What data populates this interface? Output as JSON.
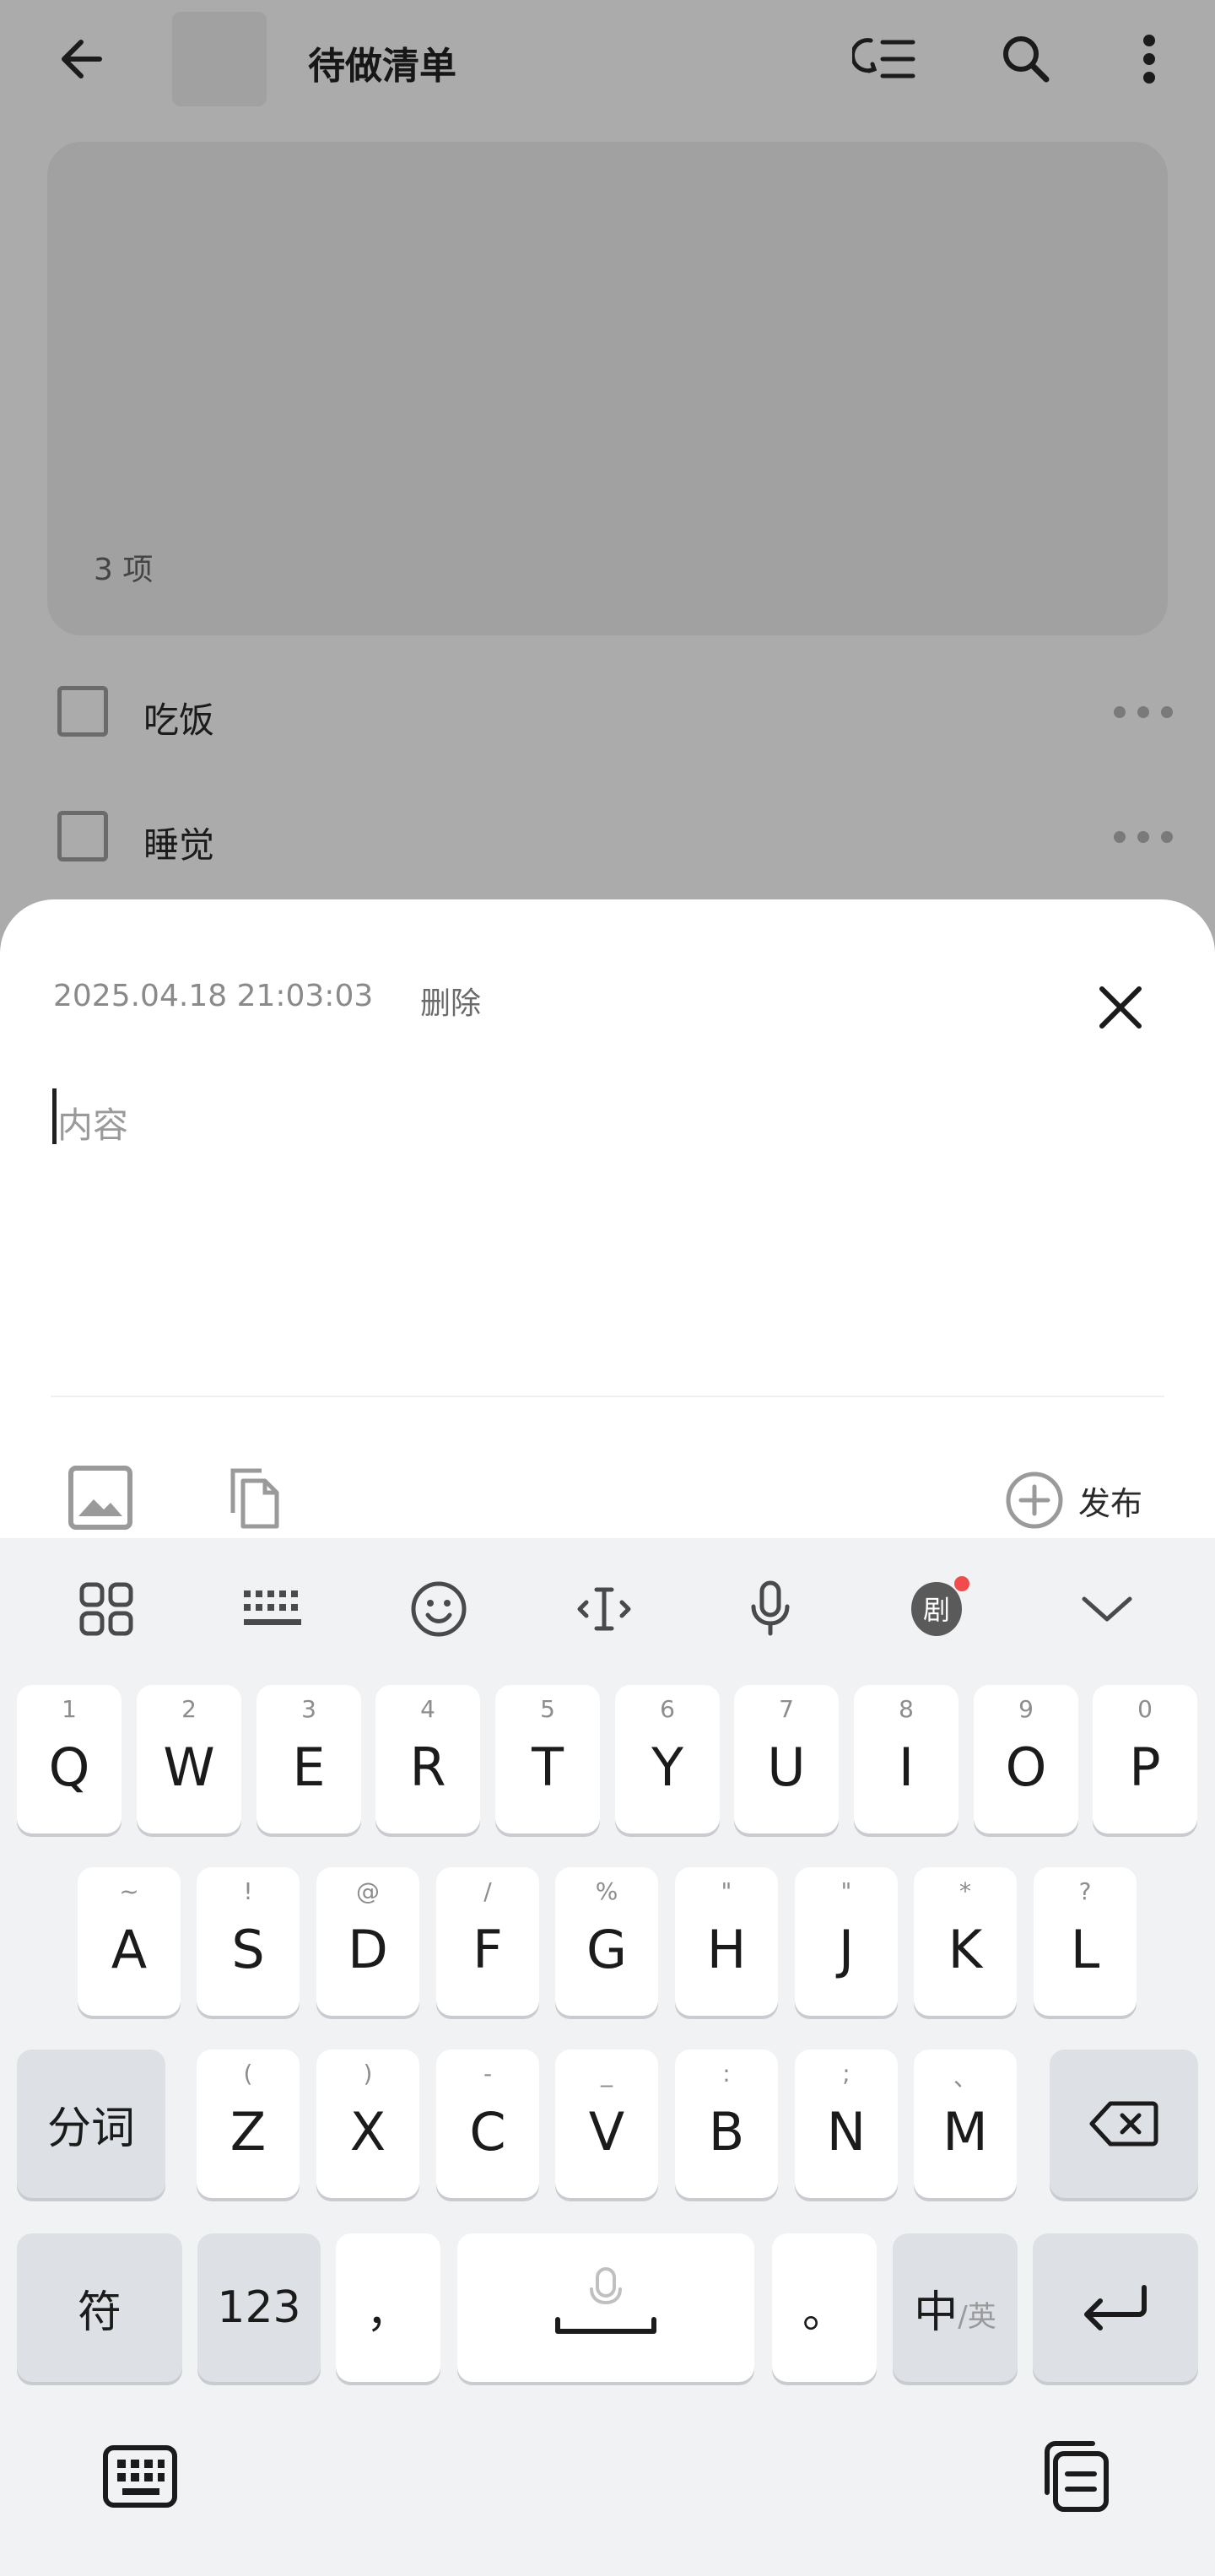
{
  "header": {
    "title": "待做清单",
    "icons": [
      "back-arrow-icon",
      "sort-icon",
      "search-icon",
      "more-vertical-icon"
    ]
  },
  "cover": {
    "count_text": "3 项"
  },
  "todos": [
    {
      "label": "吃饭",
      "checked": false
    },
    {
      "label": "睡觉",
      "checked": false
    }
  ],
  "sheet": {
    "timestamp": "2025.04.18 21:03:03",
    "delete_label": "删除",
    "content_placeholder": "内容",
    "publish_label": "发布"
  },
  "keyboard": {
    "toolbar": [
      "apps-grid-icon",
      "keyboard-layout-icon",
      "emoji-icon",
      "cursor-move-icon",
      "microphone-icon",
      "ju-badge-icon",
      "collapse-chevron-icon"
    ],
    "toolbar_badge_text": "剧",
    "row1": [
      {
        "key": "Q",
        "hint": "1"
      },
      {
        "key": "W",
        "hint": "2"
      },
      {
        "key": "E",
        "hint": "3"
      },
      {
        "key": "R",
        "hint": "4"
      },
      {
        "key": "T",
        "hint": "5"
      },
      {
        "key": "Y",
        "hint": "6"
      },
      {
        "key": "U",
        "hint": "7"
      },
      {
        "key": "I",
        "hint": "8"
      },
      {
        "key": "O",
        "hint": "9"
      },
      {
        "key": "P",
        "hint": "0"
      }
    ],
    "row2": [
      {
        "key": "A",
        "hint": "~"
      },
      {
        "key": "S",
        "hint": "!"
      },
      {
        "key": "D",
        "hint": "@"
      },
      {
        "key": "F",
        "hint": "/"
      },
      {
        "key": "G",
        "hint": "%"
      },
      {
        "key": "H",
        "hint": "\""
      },
      {
        "key": "J",
        "hint": "\""
      },
      {
        "key": "K",
        "hint": "*"
      },
      {
        "key": "L",
        "hint": "?"
      }
    ],
    "row3": [
      {
        "key": "Z",
        "hint": "("
      },
      {
        "key": "X",
        "hint": ")"
      },
      {
        "key": "C",
        "hint": "-"
      },
      {
        "key": "V",
        "hint": "_"
      },
      {
        "key": "B",
        "hint": ":"
      },
      {
        "key": "N",
        "hint": ";"
      },
      {
        "key": "M",
        "hint": "、"
      }
    ],
    "segment_label": "分词",
    "symbol_label": "符",
    "numbers_label": "123",
    "comma_label": "，",
    "period_label": "。",
    "lang_main": "中",
    "lang_sub": "/英"
  }
}
